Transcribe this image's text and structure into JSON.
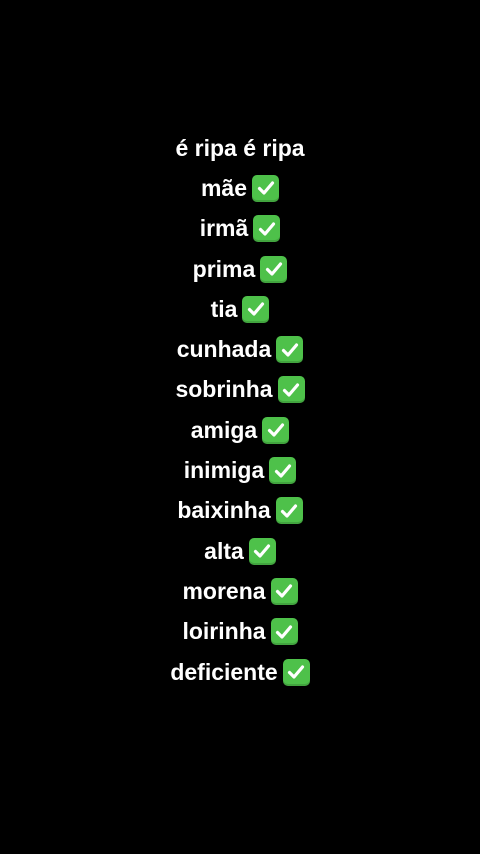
{
  "title": "é ripa é ripa",
  "items": [
    {
      "label": "mãe",
      "mark": "check-mark-icon"
    },
    {
      "label": "irmã",
      "mark": "check-mark-icon"
    },
    {
      "label": "prima",
      "mark": "check-mark-icon"
    },
    {
      "label": "tia",
      "mark": "check-mark-icon"
    },
    {
      "label": "cunhada",
      "mark": "check-mark-icon"
    },
    {
      "label": "sobrinha",
      "mark": "check-mark-icon"
    },
    {
      "label": "amiga",
      "mark": "check-mark-icon"
    },
    {
      "label": "inimiga",
      "mark": "check-mark-icon"
    },
    {
      "label": "baixinha",
      "mark": "check-mark-icon"
    },
    {
      "label": "alta",
      "mark": "check-mark-icon"
    },
    {
      "label": "morena",
      "mark": "check-mark-icon"
    },
    {
      "label": "loirinha",
      "mark": "check-mark-icon"
    },
    {
      "label": "deficiente",
      "mark": "check-mark-icon"
    }
  ],
  "colors": {
    "background": "#000000",
    "text": "#ffffff",
    "check_box": "#4ec14a",
    "check_mark": "#ffffff"
  }
}
